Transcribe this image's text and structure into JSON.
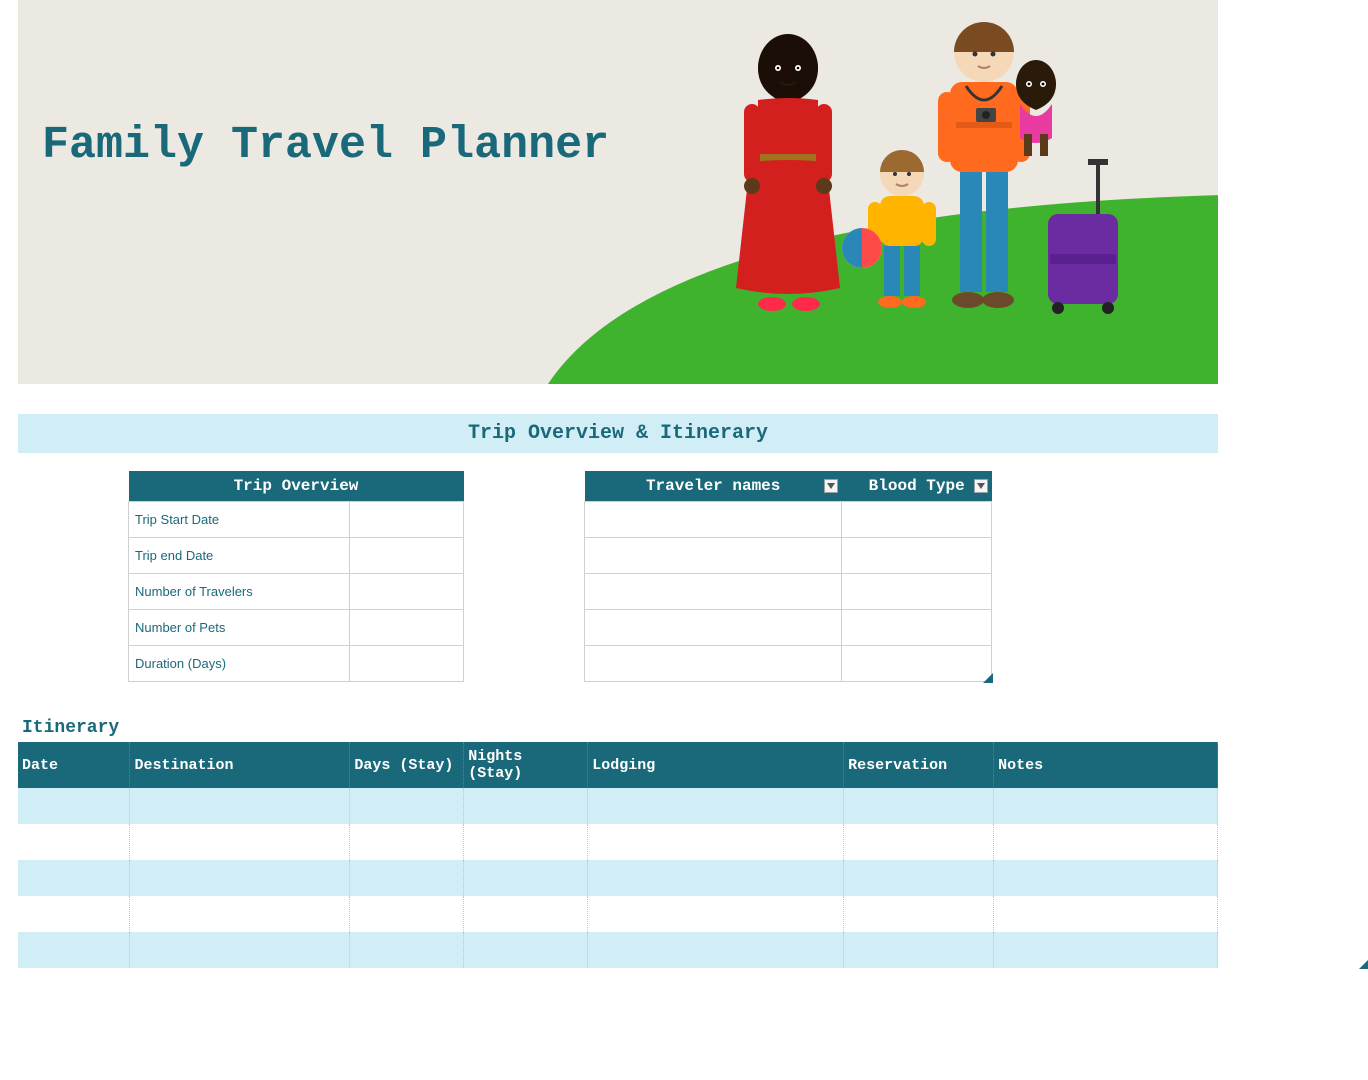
{
  "hero": {
    "title": "Family Travel Planner"
  },
  "section": {
    "banner": "Trip Overview & Itinerary"
  },
  "trip_overview": {
    "header": "Trip Overview",
    "rows": [
      {
        "label": "Trip Start Date",
        "value": ""
      },
      {
        "label": "Trip end Date",
        "value": ""
      },
      {
        "label": "Number of Travelers",
        "value": ""
      },
      {
        "label": "Number of Pets",
        "value": ""
      },
      {
        "label": "Duration (Days)",
        "value": ""
      }
    ]
  },
  "travelers": {
    "headers": {
      "names": "Traveler names",
      "blood": "Blood Type"
    },
    "rows": [
      {
        "name": "",
        "blood": ""
      },
      {
        "name": "",
        "blood": ""
      },
      {
        "name": "",
        "blood": ""
      },
      {
        "name": "",
        "blood": ""
      },
      {
        "name": "",
        "blood": ""
      }
    ]
  },
  "itinerary": {
    "label": "Itinerary",
    "columns": {
      "date": "Date",
      "destination": "Destination",
      "days": "Days (Stay)",
      "nights": "Nights (Stay)",
      "lodging": "Lodging",
      "reservation": "Reservation",
      "notes": "Notes"
    },
    "rows": [
      {
        "date": "",
        "destination": "",
        "days": "",
        "nights": "",
        "lodging": "",
        "reservation": "",
        "notes": ""
      },
      {
        "date": "",
        "destination": "",
        "days": "",
        "nights": "",
        "lodging": "",
        "reservation": "",
        "notes": ""
      },
      {
        "date": "",
        "destination": "",
        "days": "",
        "nights": "",
        "lodging": "",
        "reservation": "",
        "notes": ""
      },
      {
        "date": "",
        "destination": "",
        "days": "",
        "nights": "",
        "lodging": "",
        "reservation": "",
        "notes": ""
      },
      {
        "date": "",
        "destination": "",
        "days": "",
        "nights": "",
        "lodging": "",
        "reservation": "",
        "notes": ""
      }
    ]
  },
  "colors": {
    "teal": "#1a697a",
    "lightblue": "#d1eef6",
    "heroBg": "#ece9e3",
    "green": "#3fb22e"
  }
}
